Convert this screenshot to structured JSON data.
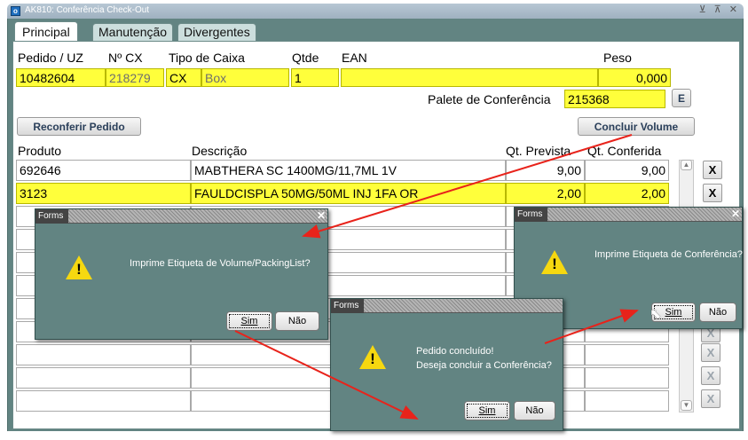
{
  "window": {
    "title": "AK810: Conferência Check-Out",
    "app_icon_label": "o",
    "controls": "⊻ ⊼ ✕"
  },
  "tabs": [
    {
      "label": "Principal"
    },
    {
      "label": "Manutenção"
    },
    {
      "label": "Divergentes"
    }
  ],
  "header": {
    "labels": {
      "pedido": "Pedido / UZ",
      "ncx": "Nº CX",
      "tipo": "Tipo de Caixa",
      "qtde": "Qtde",
      "ean": "EAN",
      "peso": "Peso"
    },
    "values": {
      "pedido": "10482604",
      "ncx": "218279",
      "tipo_code": "CX",
      "tipo_desc": "Box",
      "qtde": "1",
      "ean": "",
      "peso": "0,000"
    }
  },
  "palete": {
    "label": "Palete de Conferência",
    "value": "215368",
    "button": "E"
  },
  "buttons": {
    "reconferir": "Reconferir Pedido",
    "concluir": "Concluir Volume"
  },
  "table": {
    "columns": {
      "produto": "Produto",
      "descricao": "Descrição",
      "qt_prevista": "Qt. Prevista",
      "qt_conferida": "Qt. Conferida"
    },
    "rows": [
      {
        "produto": "692646",
        "descricao": "MABTHERA SC 1400MG/11,7ML 1V",
        "qt_prevista": "9,00",
        "qt_conferida": "9,00",
        "x": "X"
      },
      {
        "produto": "3123",
        "descricao": "FAULDCISPLA 50MG/50ML INJ 1FA OR",
        "qt_prevista": "2,00",
        "qt_conferida": "2,00",
        "x": "X"
      }
    ],
    "x_label": "X"
  },
  "dialogs": {
    "d1": {
      "title": "Forms",
      "message": "Imprime Etiqueta de Volume/PackingList?",
      "yes": "Sim",
      "no": "Não",
      "close": "✕"
    },
    "d2": {
      "title": "Forms",
      "line1": "Pedido concluído!",
      "line2": "Deseja concluir a Conferência?",
      "yes": "Sim",
      "no": "Não"
    },
    "d3": {
      "title": "Forms",
      "message": "Imprime Etiqueta de Conferência?",
      "yes": "Sim",
      "no": "Não",
      "close": "✕"
    }
  },
  "colors": {
    "field_yellow": "#ffff3b",
    "panel_teal": "#628482",
    "annotation_arrow": "#e8231b"
  }
}
